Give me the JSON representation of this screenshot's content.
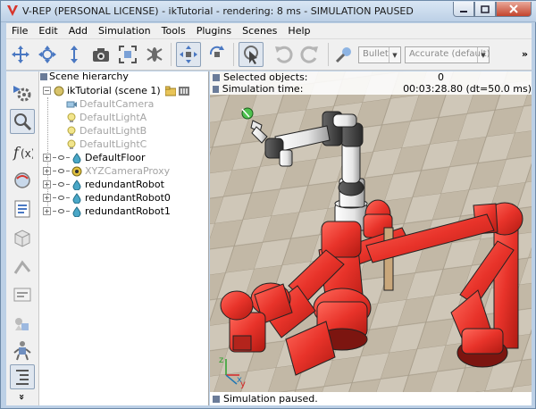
{
  "window": {
    "title": "V-REP (PERSONAL LICENSE) - ikTutorial - rendering: 8 ms - SIMULATION PAUSED"
  },
  "menu": [
    "File",
    "Edit",
    "Add",
    "Simulation",
    "Tools",
    "Plugins",
    "Scenes",
    "Help"
  ],
  "toolbar": {
    "icons": [
      "camera-pan-icon",
      "camera-rotate-icon",
      "camera-shift-icon",
      "camera-angle-icon",
      "fit-to-view-icon",
      "assemble-icon",
      "object-shift-icon",
      "object-rotate-icon",
      "click-select-icon",
      "undo-icon",
      "redo-icon",
      "physics-settings-icon"
    ],
    "engine_select": "Bullet",
    "accuracy_select": "Accurate (default)",
    "more": "»"
  },
  "left_toolbar": {
    "icons": [
      "simulation-settings-icon",
      "search-icon",
      "script-icon",
      "layers-icon",
      "selection-icon",
      "shapes-icon",
      "paths-icon",
      "calculation-icon",
      "collection-icon",
      "model-browser-icon",
      "scene-hierarchy-toggle-icon"
    ],
    "more": "»"
  },
  "hierarchy": {
    "title": "Scene hierarchy",
    "scene_label": "ikTutorial (scene 1)",
    "items": [
      {
        "label": "DefaultCamera",
        "dim": true,
        "expandable": false
      },
      {
        "label": "DefaultLightA",
        "dim": true,
        "expandable": false
      },
      {
        "label": "DefaultLightB",
        "dim": true,
        "expandable": false
      },
      {
        "label": "DefaultLightC",
        "dim": true,
        "expandable": false
      },
      {
        "label": "DefaultFloor",
        "dim": false,
        "expandable": true
      },
      {
        "label": "XYZCameraProxy",
        "dim": true,
        "expandable": true
      },
      {
        "label": "redundantRobot",
        "dim": false,
        "expandable": true
      },
      {
        "label": "redundantRobot0",
        "dim": false,
        "expandable": true
      },
      {
        "label": "redundantRobot1",
        "dim": false,
        "expandable": true
      }
    ]
  },
  "viewport": {
    "selected_objects_label": "Selected objects:",
    "selected_objects_value": "0",
    "simulation_time_label": "Simulation time:",
    "simulation_time_value": "00:03:28.80 (dt=50.0 ms)",
    "status_text": "Simulation paused.",
    "axis_x": "x",
    "axis_y": "y",
    "axis_z": "z"
  },
  "colors": {
    "robot_red": "#e8332a",
    "robot_white": "#f2f2f2",
    "floor_tile": "#cbc2b3",
    "window_frame": "#bcd0e6"
  }
}
